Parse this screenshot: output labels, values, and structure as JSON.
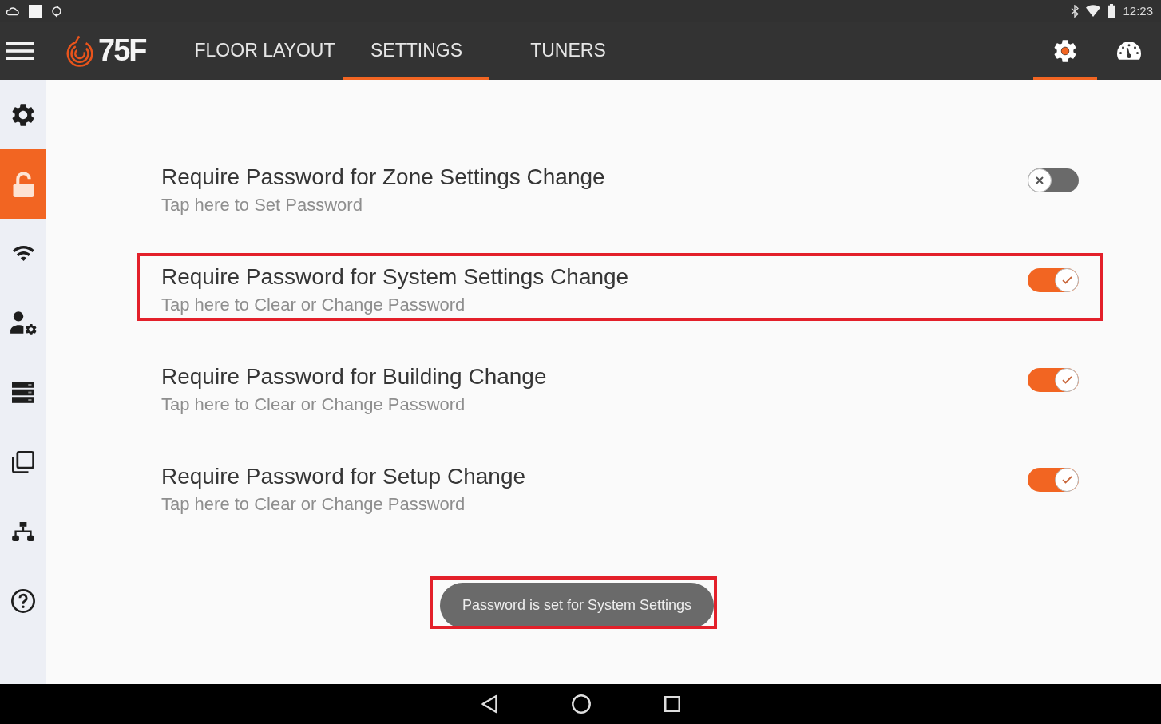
{
  "status_bar": {
    "time": "12:23"
  },
  "app_bar": {
    "logo": "75F",
    "tabs": [
      {
        "label": "FLOOR LAYOUT",
        "selected": false
      },
      {
        "label": "SETTINGS",
        "selected": true
      },
      {
        "label": "TUNERS",
        "selected": false
      }
    ],
    "icon_tabs": [
      {
        "kind": "settings",
        "selected": true
      },
      {
        "kind": "dashboard",
        "selected": false
      }
    ]
  },
  "sidebar": {
    "items": [
      {
        "kind": "settings",
        "selected": false
      },
      {
        "kind": "security",
        "selected": true
      },
      {
        "kind": "wifi",
        "selected": false
      },
      {
        "kind": "user-settings",
        "selected": false
      },
      {
        "kind": "storage",
        "selected": false
      },
      {
        "kind": "copy",
        "selected": false
      },
      {
        "kind": "network",
        "selected": false
      },
      {
        "kind": "help",
        "selected": false
      }
    ]
  },
  "settings": [
    {
      "title": "Require Password for Zone Settings Change",
      "subtitle": "Tap here to Set Password",
      "on": false,
      "highlighted": false
    },
    {
      "title": "Require Password for System Settings Change",
      "subtitle": "Tap here to Clear or Change Password",
      "on": true,
      "highlighted": true
    },
    {
      "title": "Require Password for Building Change",
      "subtitle": "Tap here to Clear or Change Password",
      "on": true,
      "highlighted": false
    },
    {
      "title": "Require Password for Setup Change",
      "subtitle": "Tap here to Clear or Change Password",
      "on": true,
      "highlighted": false
    }
  ],
  "toast": {
    "text": "Password is set for System Settings",
    "highlighted": true
  }
}
